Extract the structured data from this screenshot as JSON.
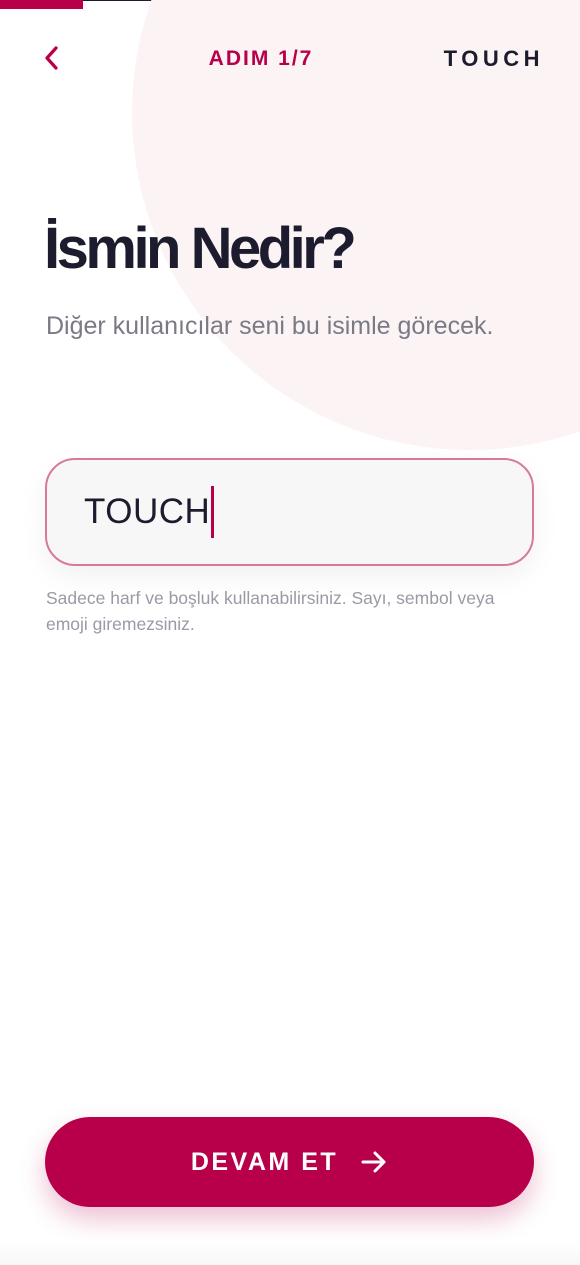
{
  "header": {
    "back_icon": "chevron-left-icon",
    "step_label": "ADIM 1/7",
    "brand": "TOUCH"
  },
  "progress": {
    "current_step": 1,
    "total_steps": 7
  },
  "main": {
    "title": "İsmin Nedir?",
    "subtitle": "Diğer kullanıcılar seni bu isimle görecek.",
    "name_input": {
      "value": "TOUCH"
    },
    "helper_text": "Sadece harf ve boşluk kullanabilirsiniz. Sayı, sembol veya emoji giremezsiniz."
  },
  "footer": {
    "continue_label": "DEVAM ET",
    "continue_icon": "arrow-right-icon"
  },
  "colors": {
    "accent": "#b8004a",
    "text_dark": "#1c1c2e",
    "text_muted": "#7a7a86",
    "field_border": "#d9799a",
    "background_circle": "#fcf3f5"
  }
}
